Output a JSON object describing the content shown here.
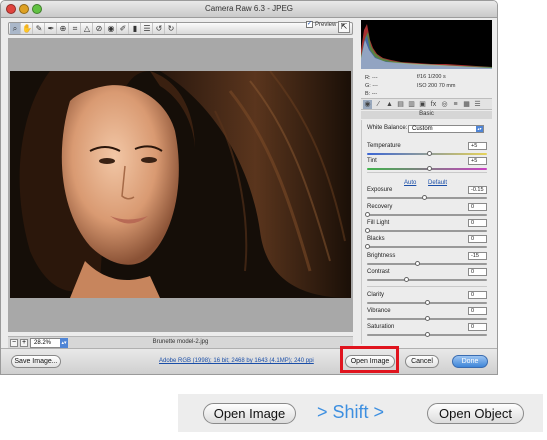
{
  "window": {
    "title": "Camera Raw 6.3  -  JPEG",
    "preview_label": "Preview"
  },
  "toolbar": {
    "tools": [
      "zoom-tool",
      "hand-tool",
      "white-balance-tool",
      "color-sampler-tool",
      "targeted-adjustment-tool",
      "crop-tool",
      "straighten-tool",
      "spot-removal-tool",
      "red-eye-tool",
      "adjustment-brush-tool",
      "graduated-filter-tool",
      "preferences-tool",
      "rotate-ccw-tool",
      "rotate-cw-tool"
    ]
  },
  "status": {
    "zoom": "28.2%",
    "filename": "Brunette model-2.jpg"
  },
  "info": {
    "r": "R:  ---",
    "g": "G:  ---",
    "b": "B:  ---",
    "aperture_shutter": "f/16   1/200 s",
    "iso_focal": "ISO 200   70 mm"
  },
  "panel": {
    "title": "Basic",
    "white_balance_label": "White Balance:",
    "white_balance_value": "Custom",
    "auto_label": "Auto",
    "default_label": "Default",
    "sliders": [
      {
        "label": "Temperature",
        "value": "+5",
        "pos": 0.52
      },
      {
        "label": "Tint",
        "value": "+5",
        "pos": 0.52
      },
      {
        "label": "Exposure",
        "value": "-0.15",
        "pos": 0.48
      },
      {
        "label": "Recovery",
        "value": "0",
        "pos": 0.0
      },
      {
        "label": "Fill Light",
        "value": "0",
        "pos": 0.0
      },
      {
        "label": "Blacks",
        "value": "0",
        "pos": 0.0
      },
      {
        "label": "Brightness",
        "value": "-15",
        "pos": 0.42
      },
      {
        "label": "Contrast",
        "value": "0",
        "pos": 0.33
      },
      {
        "label": "Clarity",
        "value": "0",
        "pos": 0.5
      },
      {
        "label": "Vibrance",
        "value": "0",
        "pos": 0.5
      },
      {
        "label": "Saturation",
        "value": "0",
        "pos": 0.5
      }
    ]
  },
  "bottom": {
    "save_image": "Save Image...",
    "workflow_options": "Adobe RGB (1998); 16 bit; 2468 by 1643 (4.1MP); 240 ppi",
    "open_image": "Open Image",
    "cancel": "Cancel",
    "done": "Done"
  },
  "callout": {
    "open_image": "Open Image",
    "shift": "> Shift >",
    "open_object": "Open Object"
  },
  "colors": {
    "highlight_box": "#e0141e",
    "shift_text": "#3d8fe0",
    "accent_blue": "#4f85d6"
  }
}
